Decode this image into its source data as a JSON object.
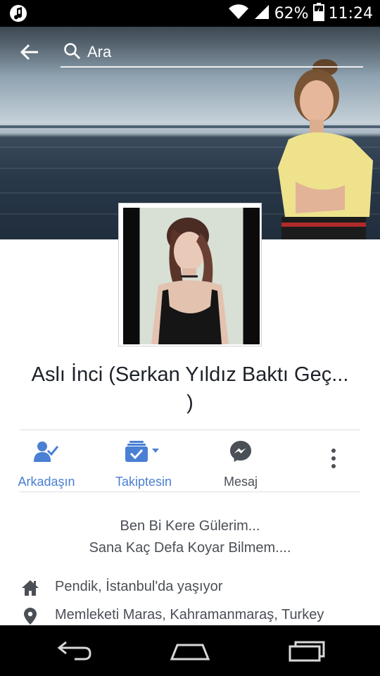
{
  "status_bar": {
    "battery_percent": "62%",
    "time": "11:24",
    "icons": [
      "music-note-icon",
      "wifi-icon",
      "signal-icon",
      "battery-charging-icon"
    ]
  },
  "top_bar": {
    "search_placeholder": "Ara",
    "icons": [
      "back-arrow-icon",
      "search-icon"
    ]
  },
  "profile": {
    "name_line1": "Aslı İnci (Serkan Yıldız Baktı Geç...",
    "name_line2": ")"
  },
  "actions": [
    {
      "label": "Arkadaşın",
      "icon": "friends-check-icon",
      "color": "#4a7fd4"
    },
    {
      "label": "Takiptesin",
      "icon": "following-check-icon",
      "color": "#4a7fd4"
    },
    {
      "label": "Mesaj",
      "icon": "messenger-icon",
      "color": "#4b4f56"
    },
    {
      "label": "",
      "icon": "more-vertical-icon",
      "color": "#4b4f56"
    }
  ],
  "bio": {
    "line1": "Ben Bi Kere Gülerim...",
    "line2": "Sana Kaç Defa Koyar Bilmem...."
  },
  "info": [
    {
      "icon": "home-icon",
      "text": "Pendik, İstanbul'da yaşıyor"
    },
    {
      "icon": "location-pin-icon",
      "text": "Memleketi Maras, Kahramanmaraş, Turkey"
    }
  ],
  "nav_bar": {
    "icons": [
      "nav-back-icon",
      "nav-home-icon",
      "nav-recents-icon"
    ]
  },
  "colors": {
    "accent": "#4a7fd4",
    "text_dark": "#1d2129",
    "text_gray": "#4b4f56",
    "divider": "#dddfe2"
  }
}
